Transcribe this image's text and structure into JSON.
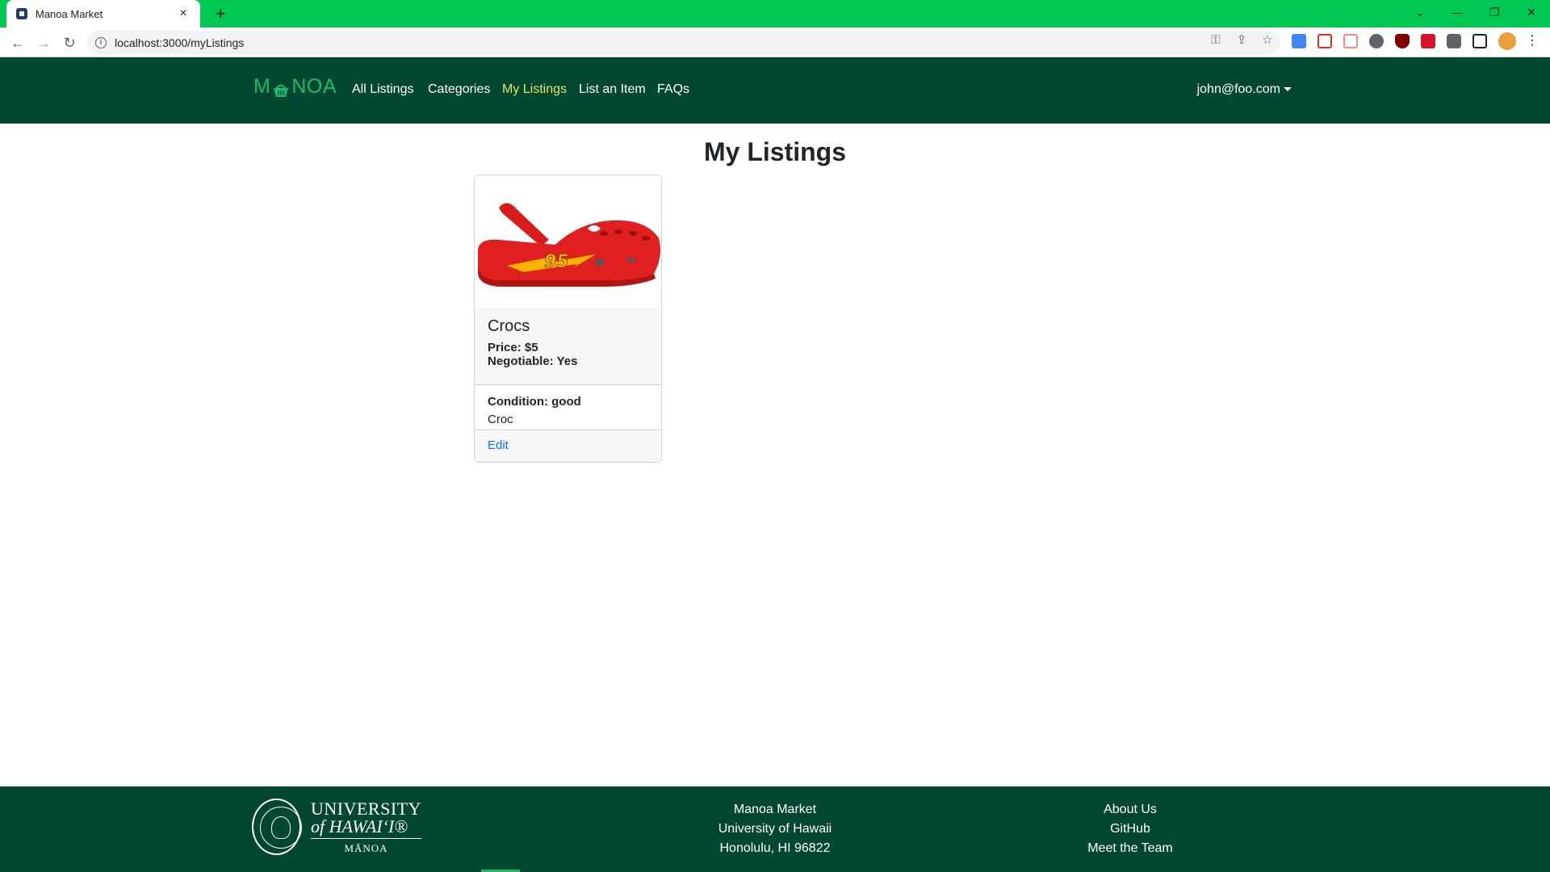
{
  "browser": {
    "tab_title": "Manoa Market",
    "url": "localhost:3000/myListings"
  },
  "navbar": {
    "brand_left": "M",
    "brand_right": "NOA",
    "links": [
      {
        "label": "All Listings",
        "active": false
      },
      {
        "label": "Categories",
        "active": false
      },
      {
        "label": "My Listings",
        "active": true
      },
      {
        "label": "List an Item",
        "active": false
      },
      {
        "label": "FAQs",
        "active": false
      }
    ],
    "user": "john@foo.com"
  },
  "main": {
    "title": "My Listings",
    "listings": [
      {
        "title": "Crocs",
        "price": "Price: $5",
        "negotiable": "Negotiable: Yes",
        "condition": "Condition: good",
        "description": "Croc",
        "edit_label": "Edit",
        "image_alt": "red-crocs-clog"
      }
    ]
  },
  "footer": {
    "logo": {
      "line1": "UNIVERSITY",
      "line2": "of HAWAI‘I®",
      "line3": "MĀNOA"
    },
    "address": [
      "Manoa Market",
      "University of Hawaii",
      "Honolulu, HI 96822"
    ],
    "links": [
      "About Us",
      "GitHub",
      "Meet the Team"
    ]
  },
  "colors": {
    "chrome": "#00c853",
    "navbar": "#024731",
    "brand": "#21b86b",
    "active_link": "#e4e56a",
    "link": "#0d6efd"
  }
}
